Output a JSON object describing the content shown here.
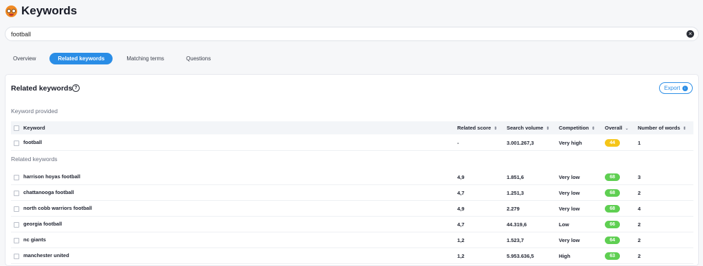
{
  "app": {
    "title": "Keywords"
  },
  "search": {
    "value": "football"
  },
  "tabs": [
    {
      "label": "Overview",
      "active": false
    },
    {
      "label": "Related keywords",
      "active": true
    },
    {
      "label": "Matching terms",
      "active": false
    },
    {
      "label": "Questions",
      "active": false
    }
  ],
  "card": {
    "title": "Related keywords",
    "export_label": "Export"
  },
  "sections": {
    "provided": "Keyword provided",
    "related": "Related keywords"
  },
  "columns": {
    "keyword": "Keyword",
    "related_score": "Related score",
    "search_volume": "Search volume",
    "competition": "Competition",
    "overall": "Overall",
    "number_of_words": "Number of words"
  },
  "provided_row": {
    "keyword": "football",
    "related_score": "-",
    "search_volume": "3.001.267,3",
    "competition": "Very high",
    "overall": "44",
    "overall_color": "#f5c518",
    "words": "1"
  },
  "rows": [
    {
      "keyword": "harrison hoyas football",
      "related_score": "4,9",
      "search_volume": "1.851,6",
      "competition": "Very low",
      "overall": "68",
      "overall_color": "#5fcf52",
      "words": "3"
    },
    {
      "keyword": "chattanooga football",
      "related_score": "4,7",
      "search_volume": "1.251,3",
      "competition": "Very low",
      "overall": "68",
      "overall_color": "#5fcf52",
      "words": "2"
    },
    {
      "keyword": "north cobb warriors football",
      "related_score": "4,9",
      "search_volume": "2.279",
      "competition": "Very low",
      "overall": "68",
      "overall_color": "#5fcf52",
      "words": "4"
    },
    {
      "keyword": "georgia football",
      "related_score": "4,7",
      "search_volume": "44.319,6",
      "competition": "Low",
      "overall": "66",
      "overall_color": "#5fcf52",
      "words": "2"
    },
    {
      "keyword": "nc giants",
      "related_score": "1,2",
      "search_volume": "1.523,7",
      "competition": "Very low",
      "overall": "64",
      "overall_color": "#5fcf52",
      "words": "2"
    },
    {
      "keyword": "manchester united",
      "related_score": "1,2",
      "search_volume": "5.953.636,5",
      "competition": "High",
      "overall": "63",
      "overall_color": "#5fcf52",
      "words": "2"
    }
  ]
}
